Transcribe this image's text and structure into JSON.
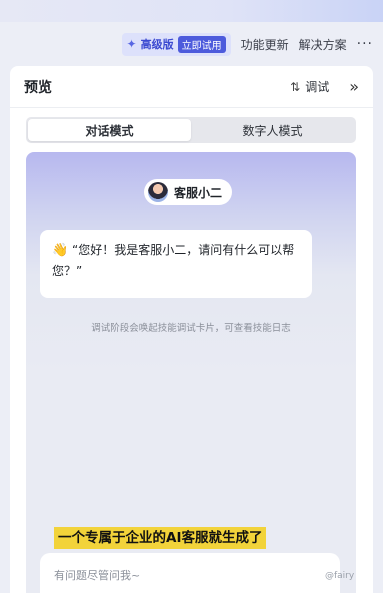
{
  "toolbar": {
    "premium_label": "高级版",
    "premium_badge": "立即试用",
    "feature_update": "功能更新",
    "solutions": "解决方案",
    "more": "···"
  },
  "panel": {
    "title": "预览",
    "debug_label": "调试"
  },
  "mode_tabs": [
    {
      "label": "对话模式",
      "active": true
    },
    {
      "label": "数字人模式",
      "active": false
    }
  ],
  "chat": {
    "bot_name": "客服小二",
    "greeting_text": "“您好！我是客服小二，请问有什么可以帮您？”",
    "hint": "调试阶段会唤起技能调试卡片，可查看技能日志",
    "input_placeholder": "有问题尽管问我~"
  },
  "caption": "一个专属于企业的AI客服就生成了",
  "watermark": "@fairy",
  "colors": {
    "accent": "#4d5bdc",
    "caption_bg": "#f2d33a"
  }
}
